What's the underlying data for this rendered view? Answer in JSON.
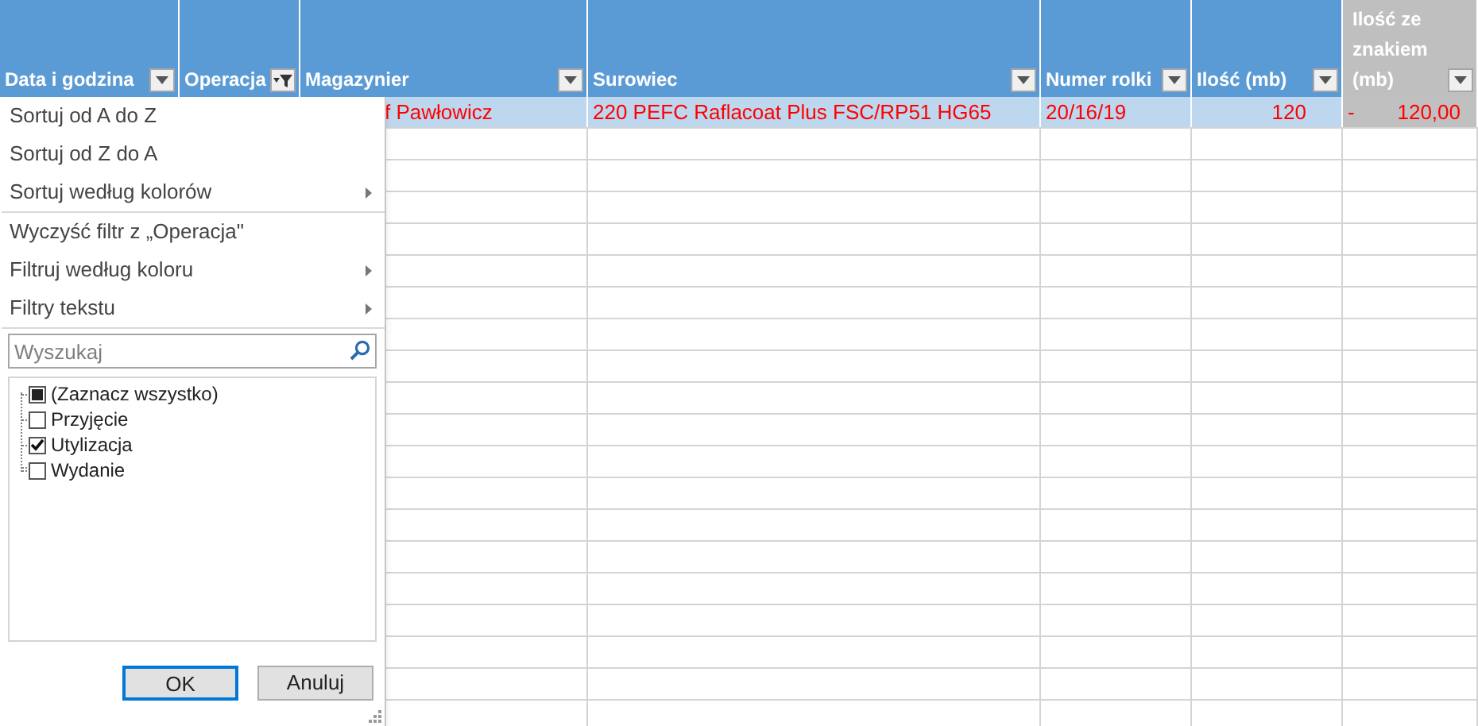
{
  "table": {
    "columns": [
      {
        "label": "Data i godzina",
        "filter_applied": false,
        "color": "#5b9bd5"
      },
      {
        "label": "Operacja",
        "filter_applied": true,
        "color": "#5b9bd5"
      },
      {
        "label": "Magazynier",
        "filter_applied": false,
        "color": "#5b9bd5"
      },
      {
        "label": "Surowiec",
        "filter_applied": false,
        "color": "#5b9bd5"
      },
      {
        "label": "Numer rolki",
        "filter_applied": false,
        "color": "#5b9bd5"
      },
      {
        "label": "Ilość (mb)",
        "filter_applied": false,
        "color": "#5b9bd5"
      },
      {
        "label": "Ilość ze znakiem (mb)",
        "filter_applied": false,
        "color": "#bfbfbf"
      }
    ],
    "row": {
      "magazynier": "f Pawłowicz",
      "surowiec": "220 PEFC Raflacoat Plus FSC/RP51 HG65",
      "numer_rolki": "20/16/19",
      "ilosc": "120",
      "sign": "-",
      "ilosc_ze_znakiem": "120,00"
    }
  },
  "filter_menu": {
    "sections": [
      [
        {
          "label": "Sortuj od A do Z",
          "kind": "action"
        },
        {
          "label": "Sortuj od Z do A",
          "kind": "action"
        },
        {
          "label": "Sortuj według kolorów",
          "kind": "submenu"
        }
      ],
      [
        {
          "label": "Wyczyść filtr z „Operacja\"",
          "kind": "action"
        },
        {
          "label": "Filtruj według koloru",
          "kind": "submenu"
        },
        {
          "label": "Filtry tekstu",
          "kind": "submenu"
        }
      ]
    ],
    "search": {
      "placeholder": "Wyszukaj"
    },
    "values": [
      {
        "label": "(Zaznacz wszystko)",
        "checked": false,
        "indeterminate": true
      },
      {
        "label": "Przyjęcie",
        "checked": false,
        "indeterminate": false
      },
      {
        "label": "Utylizacja",
        "checked": true,
        "indeterminate": false
      },
      {
        "label": "Wydanie",
        "checked": false,
        "indeterminate": false
      }
    ],
    "buttons": [
      {
        "label": "OK",
        "default": true
      },
      {
        "label": "Anuluj",
        "default": false
      }
    ]
  }
}
